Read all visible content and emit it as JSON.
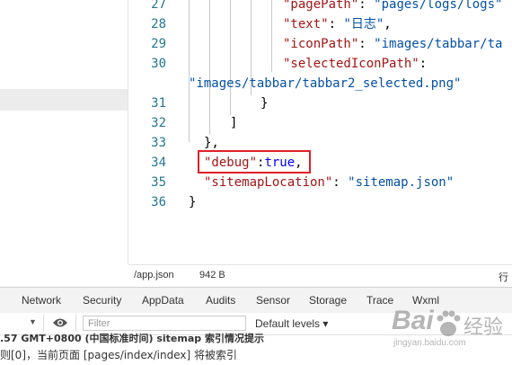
{
  "editor": {
    "lines": [
      {
        "num": "27",
        "parts": [
          [
            "key",
            "\"pagePath\""
          ],
          [
            "pun",
            ": "
          ],
          [
            "str",
            "\"pages/logs/logs\""
          ]
        ]
      },
      {
        "num": "28",
        "parts": [
          [
            "key",
            "\"text\""
          ],
          [
            "pun",
            ": "
          ],
          [
            "str",
            "\"日志\""
          ],
          [
            "pun",
            ","
          ]
        ]
      },
      {
        "num": "29",
        "parts": [
          [
            "key",
            "\"iconPath\""
          ],
          [
            "pun",
            ": "
          ],
          [
            "str",
            "\"images/tabbar/ta"
          ]
        ]
      },
      {
        "num": "30",
        "parts": [
          [
            "key",
            "\"selectedIconPath\""
          ],
          [
            "pun",
            ":"
          ]
        ]
      },
      {
        "num": "",
        "parts": [
          [
            "str",
            "\"images/tabbar/tabbar2_selected.png\""
          ]
        ]
      },
      {
        "num": "31",
        "parts": [
          [
            "pun",
            "}"
          ]
        ]
      },
      {
        "num": "32",
        "parts": [
          [
            "pun",
            "]"
          ]
        ]
      },
      {
        "num": "33",
        "parts": [
          [
            "pun",
            "},"
          ]
        ]
      },
      {
        "num": "34",
        "parts": [
          [
            "key",
            "\"debug\""
          ],
          [
            "pun",
            ":"
          ],
          [
            "bool",
            "true"
          ],
          [
            "pun",
            ","
          ]
        ]
      },
      {
        "num": "35",
        "parts": [
          [
            "key",
            "\"sitemapLocation\""
          ],
          [
            "pun",
            ": "
          ],
          [
            "str",
            "\"sitemap.json\""
          ]
        ]
      },
      {
        "num": "36",
        "parts": [
          [
            "pun",
            "}"
          ]
        ]
      }
    ]
  },
  "status": {
    "file": "/app.json",
    "size": "942 B",
    "right": "行"
  },
  "devtools": {
    "tabs": [
      "Network",
      "Security",
      "AppData",
      "Audits",
      "Sensor",
      "Storage",
      "Trace",
      "Wxml"
    ],
    "filter_placeholder": "Filter",
    "levels": "Default levels ▾",
    "dropdown_arrow": "▼"
  },
  "console": {
    "line1": ".57 GMT+0800 (中国标准时间) sitemap 索引情况提示",
    "line2": "则[0]，当前页面 [pages/index/index] 将被索引"
  },
  "watermark": {
    "brand": "Bai",
    "brand2": "经验",
    "url": "jingyan.baidu.com"
  },
  "colors": {
    "highlight_box": "#e0202a",
    "line_number": "#237893",
    "key": "#a31515",
    "string": "#0451a5"
  }
}
